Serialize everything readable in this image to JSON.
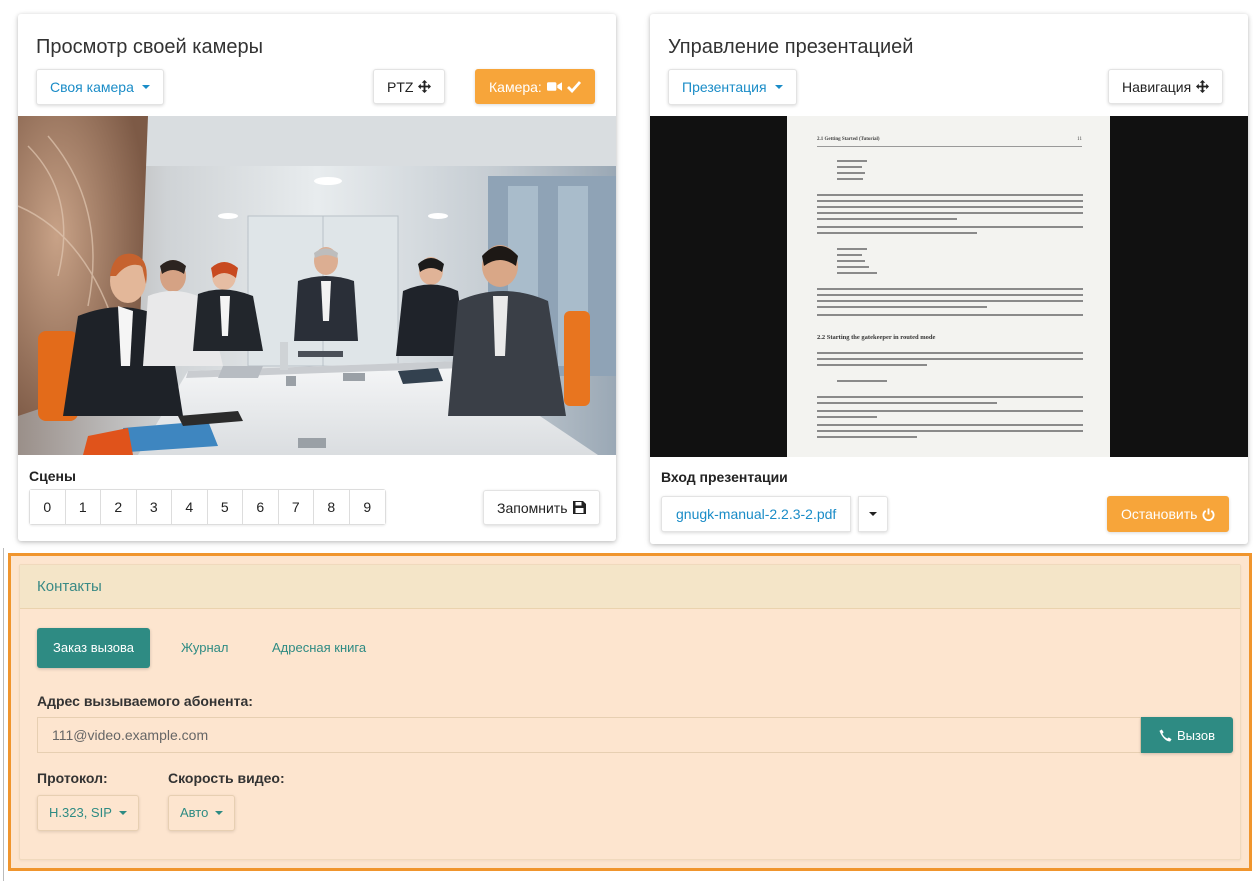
{
  "camera_panel": {
    "title": "Просмотр своей камеры",
    "source_dropdown": "Своя камера",
    "ptz_button": "PTZ",
    "camera_toggle": "Камера:",
    "scenes_label": "Сцены",
    "scenes": [
      "0",
      "1",
      "2",
      "3",
      "4",
      "5",
      "6",
      "7",
      "8",
      "9"
    ],
    "save_button": "Запомнить"
  },
  "presentation_panel": {
    "title": "Управление презентацией",
    "source_dropdown": "Презентация",
    "navigation_button": "Навигация",
    "input_label": "Вход презентации",
    "file_name": "gnugk-manual-2.2.3-2.pdf",
    "stop_button": "Остановить",
    "document_heading": "2.1 Getting Started (Tutorial)",
    "document_section": "2.2 Starting the gatekeeper in routed mode",
    "document_page_num": "11"
  },
  "contacts": {
    "title": "Контакты",
    "tabs": [
      "Заказ вызова",
      "Журнал",
      "Адресная книга"
    ],
    "active_tab": 0,
    "address_label": "Адрес вызываемого абонента:",
    "address_value": "111@video.example.com",
    "call_button": "Вызов",
    "protocol_label": "Протокол:",
    "protocol_value": "H.323, SIP",
    "speed_label": "Скорость видео:",
    "speed_value": "Авто"
  },
  "colors": {
    "link": "#1a8cc7",
    "accent_orange": "#f7a53a",
    "teal": "#2e8b83",
    "contacts_bg": "#fde5cf",
    "contacts_border": "#f0952d"
  },
  "icons": {
    "ptz": "move-arrows-icon",
    "camera": "video-camera-icon",
    "check": "checkmark-icon",
    "save": "floppy-disk-icon",
    "navigation": "move-arrows-icon",
    "stop": "power-icon",
    "call": "phone-icon"
  }
}
